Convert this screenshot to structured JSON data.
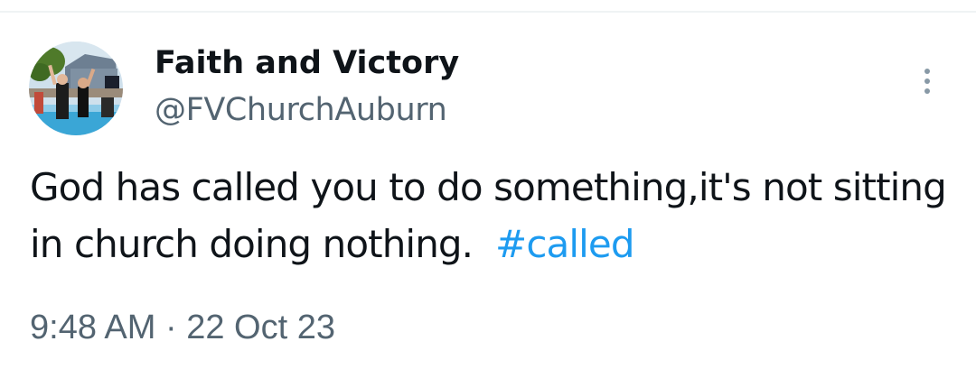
{
  "tweet": {
    "author": {
      "display_name": "Faith and Victory",
      "handle": "@FVChurchAuburn",
      "avatar_icon": "profile-photo-avatar"
    },
    "text": "God has called you to do something,it's not sitting in church doing nothing.",
    "hashtag": "#called",
    "time": "9:48 AM",
    "separator": "·",
    "date": "22 Oct 23",
    "more_icon": "vertical-ellipsis-icon"
  },
  "colors": {
    "text_primary": "#0f1419",
    "text_secondary": "#536471",
    "link": "#1d9bf0",
    "divider": "#eff3f4"
  }
}
